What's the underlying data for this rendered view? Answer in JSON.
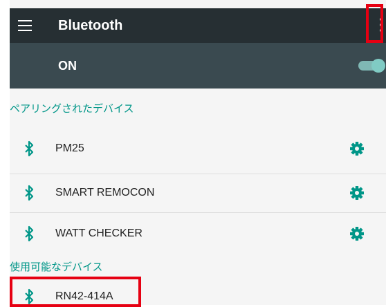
{
  "header": {
    "title": "Bluetooth",
    "menu_icon": "hamburger-menu-icon",
    "overflow_icon": "more-vert-icon"
  },
  "toggle": {
    "label": "ON",
    "state": "on"
  },
  "paired": {
    "header": "ペアリングされたデバイス",
    "devices": [
      {
        "name": "PM25"
      },
      {
        "name": "SMART REMOCON"
      },
      {
        "name": "WATT CHECKER"
      }
    ]
  },
  "available": {
    "header": "使用可能なデバイス",
    "devices": [
      {
        "name": "RN42-414A"
      }
    ]
  },
  "colors": {
    "appbar": "#262f33",
    "toggle_row": "#3a4a50",
    "accent": "#009688",
    "switch_on": "#80cbc4",
    "highlight": "#e60012"
  }
}
